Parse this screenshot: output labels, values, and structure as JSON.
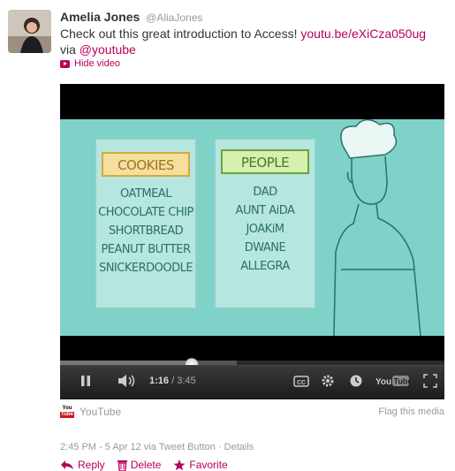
{
  "tweet": {
    "name": "Amelia Jones",
    "handle": "@AliaJones",
    "text": "Check out this great introduction to Access! ",
    "link": "youtu.be/eXiCza050ug",
    "via_text": "via ",
    "via_link": "@youtube",
    "hide_video": "Hide video"
  },
  "video": {
    "card_left_title": "COOKIES",
    "card_left_items": [
      "OATMEAL",
      "CHOCOLATE CHIP",
      "SHORTBREAD",
      "PEANUT BUTTER",
      "SNICKERDOODLE"
    ],
    "card_right_title": "PEOPLE",
    "card_right_items": [
      "DAD",
      "AUNT AiDA",
      "JOAKiM",
      "DWANE",
      "ALLEGRA"
    ],
    "current_time": "1:16",
    "duration": "3:45",
    "progress_fraction": 0.34,
    "loaded_fraction": 0.46
  },
  "media": {
    "source": "YouTube",
    "flag": "Flag this media"
  },
  "meta": {
    "timestamp": "2:45 PM - 5 Apr 12 via Tweet Button · Details"
  },
  "actions": {
    "reply": "Reply",
    "delete": "Delete",
    "favorite": "Favorite"
  },
  "colors": {
    "link": "#b8005c",
    "video_bg": "#7ed2c8"
  }
}
